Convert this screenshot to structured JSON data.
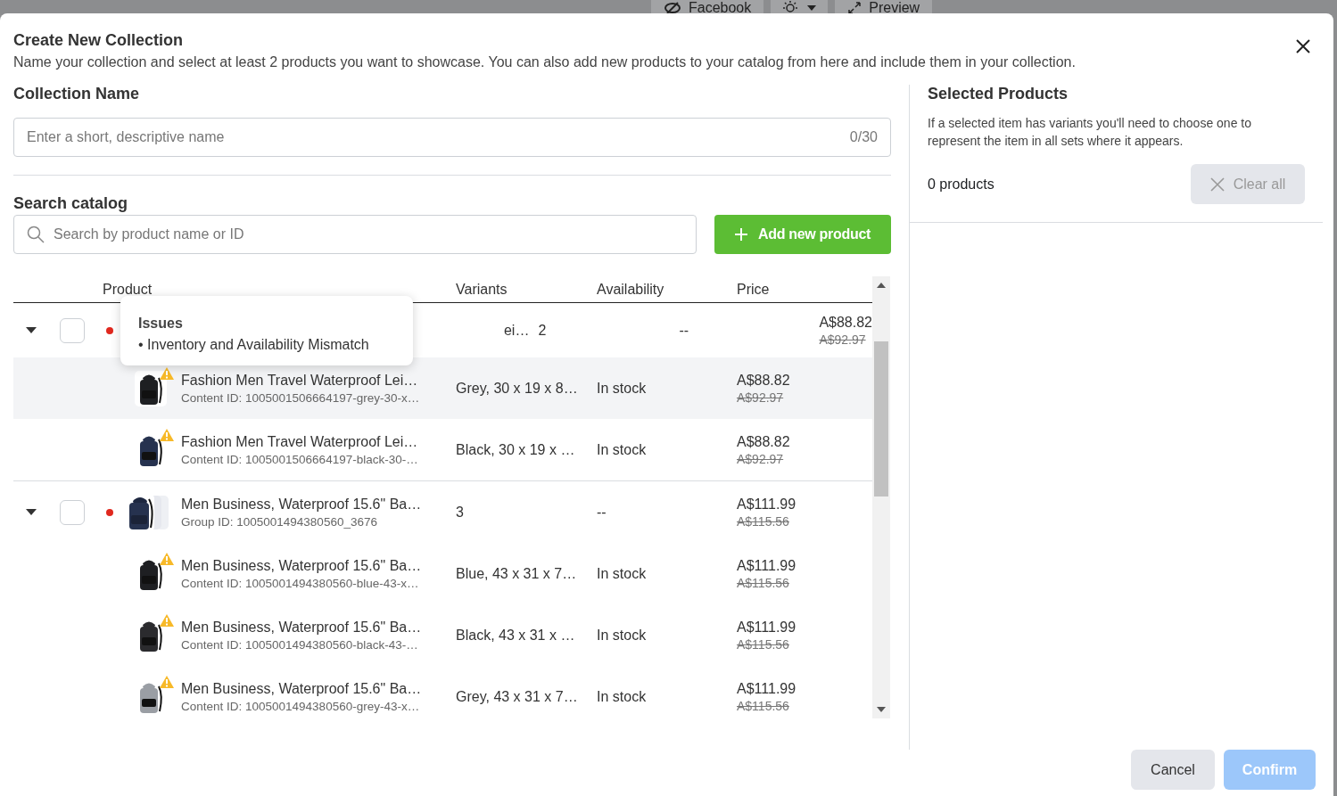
{
  "backdrop": {
    "items": [
      {
        "kind": "eye",
        "label": "Facebook"
      },
      {
        "kind": "theme"
      },
      {
        "kind": "expand",
        "label": "Preview"
      }
    ]
  },
  "dialog": {
    "title": "Create New Collection",
    "subtitle": "Name your collection and select at least 2 products you want to showcase. You can also add new products to your catalog from here and include them in your collection."
  },
  "collection_name": {
    "label": "Collection Name",
    "placeholder": "Enter a short, descriptive name",
    "counter": "0/30"
  },
  "search": {
    "label": "Search catalog",
    "placeholder": "Search by product name or ID",
    "add_button": "Add new product"
  },
  "table": {
    "columns": [
      "Product",
      "Variants",
      "Availability",
      "Price"
    ],
    "groups": [
      {
        "expanded": true,
        "checked": false,
        "issue": true,
        "name": "ei…",
        "covered": true,
        "variants": "2",
        "availability": "--",
        "price": "A$88.82",
        "old_price": "A$92.97",
        "children": [
          {
            "highlighted": true,
            "warning": true,
            "name": "Fashion Men Travel Waterproof Lei…",
            "sub": "Content ID: 1005001506664197-grey-30-x…",
            "variants": "Grey, 30 x 19 x 8…",
            "availability": "In stock",
            "price": "A$88.82",
            "old_price": "A$92.97"
          },
          {
            "highlighted": false,
            "warning": true,
            "name": "Fashion Men Travel Waterproof Lei…",
            "sub": "Content ID: 1005001506664197-black-30-…",
            "variants": "Black, 30 x 19 x …",
            "availability": "In stock",
            "price": "A$88.82",
            "old_price": "A$92.97"
          }
        ]
      },
      {
        "expanded": true,
        "checked": false,
        "issue": true,
        "name": "Men Business, Waterproof 15.6\" Ba…",
        "sub": "Group ID: 1005001494380560_3676",
        "covered": false,
        "variants": "3",
        "availability": "--",
        "price": "A$111.99",
        "old_price": "A$115.56",
        "children": [
          {
            "highlighted": false,
            "warning": true,
            "name": "Men Business, Waterproof 15.6\" Ba…",
            "sub": "Content ID: 1005001494380560-blue-43-x…",
            "variants": "Blue, 43 x 31 x 7…",
            "availability": "In stock",
            "price": "A$111.99",
            "old_price": "A$115.56"
          },
          {
            "highlighted": false,
            "warning": true,
            "name": "Men Business, Waterproof 15.6\" Ba…",
            "sub": "Content ID: 1005001494380560-black-43-…",
            "variants": "Black, 43 x 31 x …",
            "availability": "In stock",
            "price": "A$111.99",
            "old_price": "A$115.56"
          },
          {
            "highlighted": false,
            "warning": true,
            "name": "Men Business, Waterproof 15.6\" Ba…",
            "sub": "Content ID: 1005001494380560-grey-43-x…",
            "variants": "Grey, 43 x 31 x 7…",
            "availability": "In stock",
            "price": "A$111.99",
            "old_price": "A$115.56"
          }
        ]
      }
    ]
  },
  "tooltip": {
    "title": "Issues",
    "items": [
      "• Inventory and Availability Mismatch"
    ]
  },
  "selected_panel": {
    "title": "Selected Products",
    "note": "If a selected item has variants you'll need to choose one to represent the item in all sets where it appears.",
    "count": "0 products",
    "clear_button": {
      "label": "Clear all",
      "disabled": true
    }
  },
  "footer": {
    "cancel": "Cancel",
    "confirm": {
      "label": "Confirm",
      "disabled": true
    }
  }
}
